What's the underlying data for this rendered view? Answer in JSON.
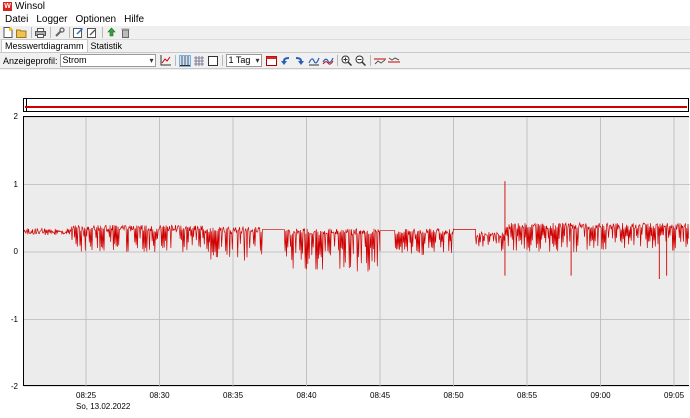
{
  "window": {
    "title": "Winsol",
    "app_icon_letter": "W"
  },
  "menu": {
    "items": [
      "Datei",
      "Logger",
      "Optionen",
      "Hilfe"
    ]
  },
  "tabs": [
    {
      "label": "Messwertdiagramm",
      "active": true
    },
    {
      "label": "Statistik",
      "active": false
    }
  ],
  "toolbar2": {
    "profile_label": "Anzeigeprofil:",
    "profile_value": "Strom",
    "range_value": "1 Tag"
  },
  "colors": {
    "series": "#d00000",
    "plot_bg": "#ececec",
    "grid": "#b8b8b8"
  },
  "chart_data": {
    "type": "line",
    "y_ticks": [
      2,
      1,
      0,
      -1,
      -2
    ],
    "ylim": [
      -2,
      2
    ],
    "x_ticks": [
      "08:25",
      "08:30",
      "08:35",
      "08:40",
      "08:45",
      "08:50",
      "08:55",
      "09:00",
      "09:05"
    ],
    "date_label": "So, 13.02.2022",
    "series": [
      {
        "values_summary": "noisy current trace mostly between 0.0 and 0.45, baseline ~0.35",
        "segments": [
          {
            "from": "08:20",
            "to": "08:24",
            "low": 0.25,
            "high": 0.4
          },
          {
            "from": "08:24",
            "to": "08:33",
            "low": 0.0,
            "high": 0.45
          },
          {
            "from": "08:33",
            "to": "08:37",
            "low": -0.15,
            "high": 0.42
          },
          {
            "from": "08:37",
            "to": "08:38.5",
            "low": 0.32,
            "high": 0.34
          },
          {
            "from": "08:38.5",
            "to": "08:45",
            "low": -0.3,
            "high": 0.4
          },
          {
            "from": "08:45",
            "to": "08:46",
            "low": 0.3,
            "high": 0.33
          },
          {
            "from": "08:46",
            "to": "08:50",
            "low": -0.05,
            "high": 0.4
          },
          {
            "from": "08:50",
            "to": "08:51.5",
            "low": 0.33,
            "high": 0.34
          },
          {
            "from": "08:51.5",
            "to": "08:53.5",
            "low": 0.0,
            "high": 0.35
          },
          {
            "from": "08:53.5",
            "to": "09:06",
            "low": 0.0,
            "high": 0.48
          }
        ],
        "spikes": [
          {
            "x": "08:53.5",
            "high": 1.05,
            "low": -0.35
          },
          {
            "x": "09:04",
            "low": -0.4
          },
          {
            "x": "09:04.5",
            "low": -0.35
          },
          {
            "x": "08:58",
            "low": -0.35
          }
        ]
      }
    ]
  }
}
